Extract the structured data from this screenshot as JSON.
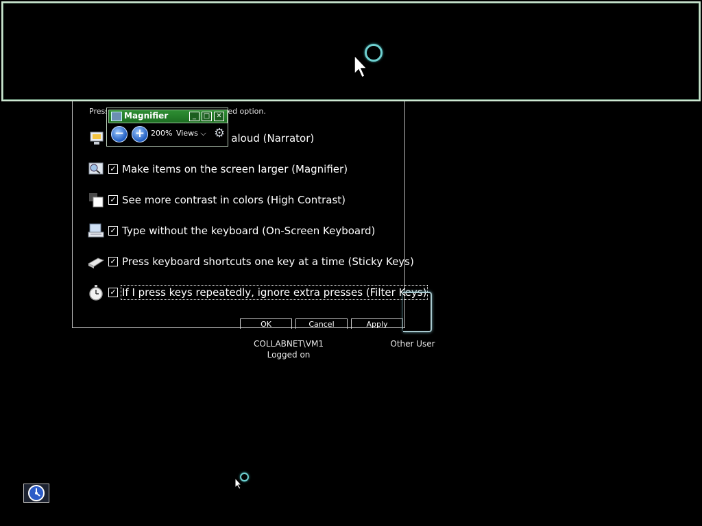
{
  "lens": {},
  "dialog": {
    "instruction_start": "Press",
    "instruction_end": "ted option.",
    "options": [
      {
        "label": "Hear text on the screen read aloud (Narrator)",
        "visible_label": "d aloud (Narrator)",
        "checked": true,
        "icon": "narrator-icon"
      },
      {
        "label": "Make items on the screen larger (Magnifier)",
        "checked": true,
        "icon": "magnifier-icon"
      },
      {
        "label": "See more contrast in colors (High Contrast)",
        "checked": true,
        "icon": "high-contrast-icon"
      },
      {
        "label": "Type without the keyboard (On-Screen Keyboard)",
        "checked": true,
        "icon": "keyboard-icon"
      },
      {
        "label": "Press keyboard shortcuts one key at a time (Sticky Keys)",
        "checked": true,
        "icon": "sticky-keys-icon"
      },
      {
        "label": "If I press keys repeatedly, ignore extra presses (Filter Keys)",
        "checked": true,
        "icon": "stopwatch-icon"
      }
    ],
    "buttons": {
      "ok": "OK",
      "cancel": "Cancel",
      "apply": "Apply"
    }
  },
  "magnifier": {
    "title": "Magnifier",
    "zoom": "200%",
    "views": "Views",
    "minus": "−",
    "plus": "+"
  },
  "users": {
    "current_name": "COLLABNET\\VM1",
    "current_status": "Logged on",
    "other": "Other User"
  },
  "colors": {
    "magnifier_title": "#2f8f34",
    "lens_border": "#cfe8d3",
    "busy_ring": "#6fd0d0"
  }
}
